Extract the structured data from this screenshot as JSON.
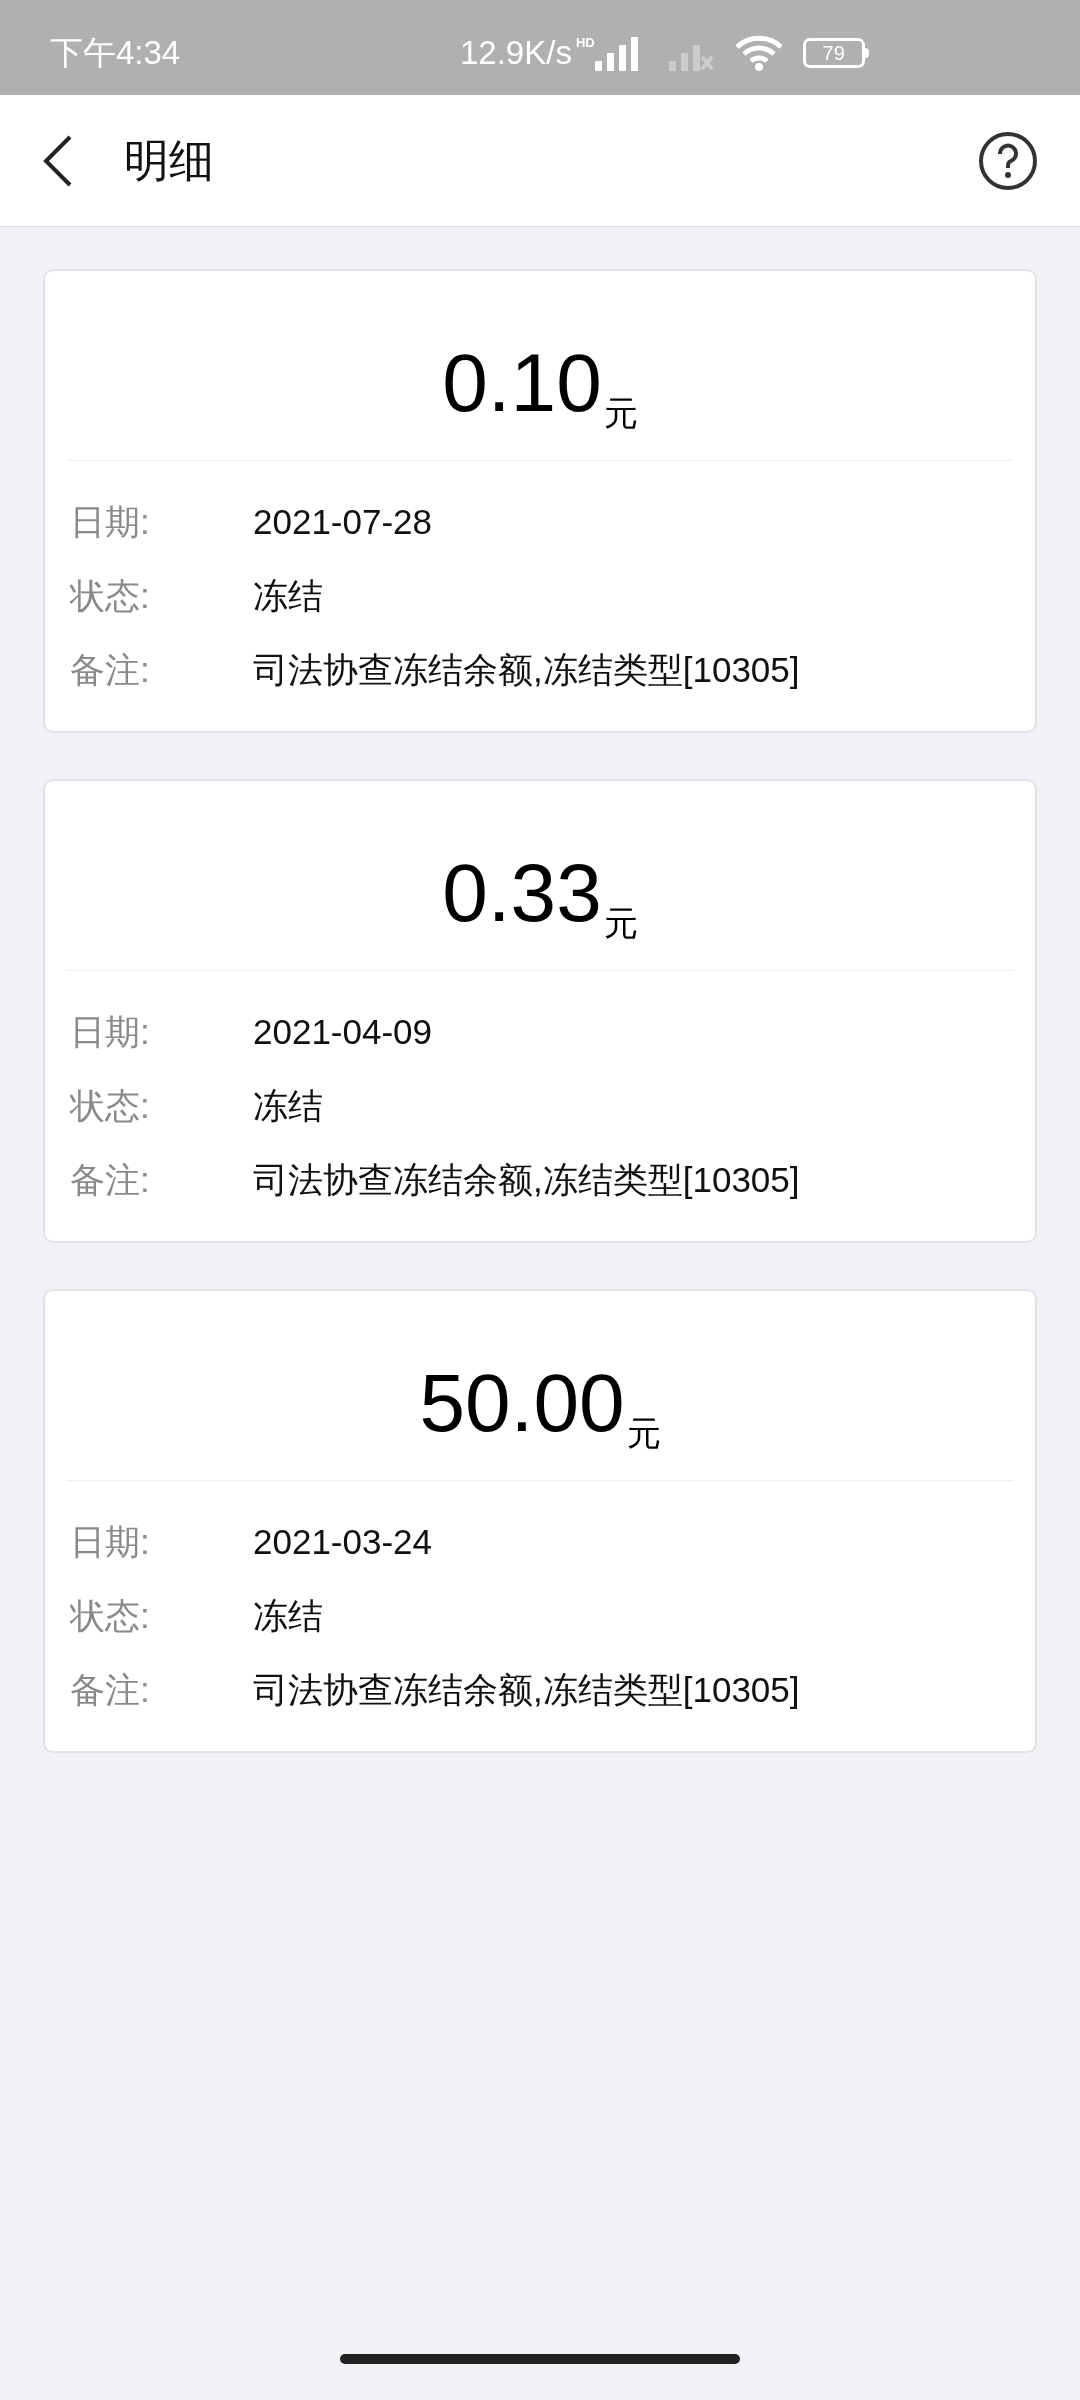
{
  "status_bar": {
    "time": "下午4:34",
    "speed": "12.9K/s",
    "network": "HD",
    "battery": "79"
  },
  "header": {
    "title": "明细"
  },
  "records": [
    {
      "amount": "0.10",
      "unit": "元",
      "fields": [
        {
          "label": "日期:",
          "value": "2021-07-28"
        },
        {
          "label": "状态:",
          "value": "冻结"
        },
        {
          "label": "备注:",
          "value": "司法协查冻结余额,冻结类型[10305]"
        }
      ]
    },
    {
      "amount": "0.33",
      "unit": "元",
      "fields": [
        {
          "label": "日期:",
          "value": "2021-04-09"
        },
        {
          "label": "状态:",
          "value": "冻结"
        },
        {
          "label": "备注:",
          "value": "司法协查冻结余额,冻结类型[10305]"
        }
      ]
    },
    {
      "amount": "50.00",
      "unit": "元",
      "fields": [
        {
          "label": "日期:",
          "value": "2021-03-24"
        },
        {
          "label": "状态:",
          "value": "冻结"
        },
        {
          "label": "备注:",
          "value": "司法协查冻结余额,冻结类型[10305]"
        }
      ]
    }
  ]
}
